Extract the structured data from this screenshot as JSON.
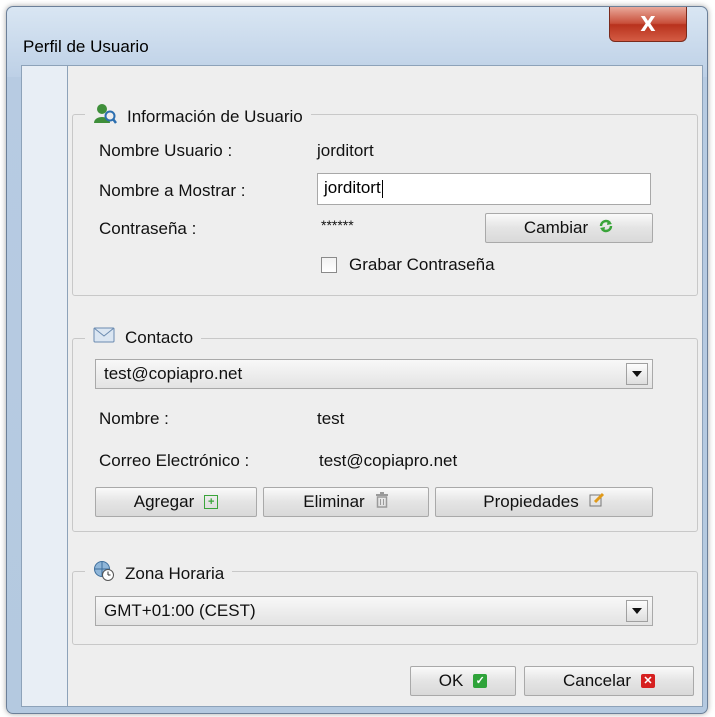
{
  "window": {
    "title": "Perfil de Usuario",
    "close_glyph": "X"
  },
  "user_info": {
    "legend": "Información de Usuario",
    "icon": "user-icon",
    "username_label": "Nombre Usuario :",
    "username_value": "jorditort",
    "display_name_label": "Nombre a Mostrar :",
    "display_name_value": "jorditort",
    "password_label": "Contraseña :",
    "password_value": "******",
    "change_button": "Cambiar",
    "save_password_label": "Grabar Contraseña",
    "save_password_checked": false
  },
  "contact": {
    "legend": "Contacto",
    "icon": "envelope-icon",
    "selected": "test@copiapro.net",
    "name_label": "Nombre :",
    "name_value": "test",
    "email_label": "Correo Electrónico :",
    "email_value": "test@copiapro.net",
    "add_button": "Agregar",
    "delete_button": "Eliminar",
    "properties_button": "Propiedades"
  },
  "timezone": {
    "legend": "Zona Horaria",
    "icon": "globe-clock-icon",
    "selected": "GMT+01:00 (CEST)"
  },
  "footer": {
    "ok_button": "OK",
    "cancel_button": "Cancelar"
  },
  "colors": {
    "ok_green": "#2fa33a",
    "cancel_red": "#d62020",
    "refresh_green": "#3aa43a",
    "edit_orange": "#e09a1a"
  }
}
